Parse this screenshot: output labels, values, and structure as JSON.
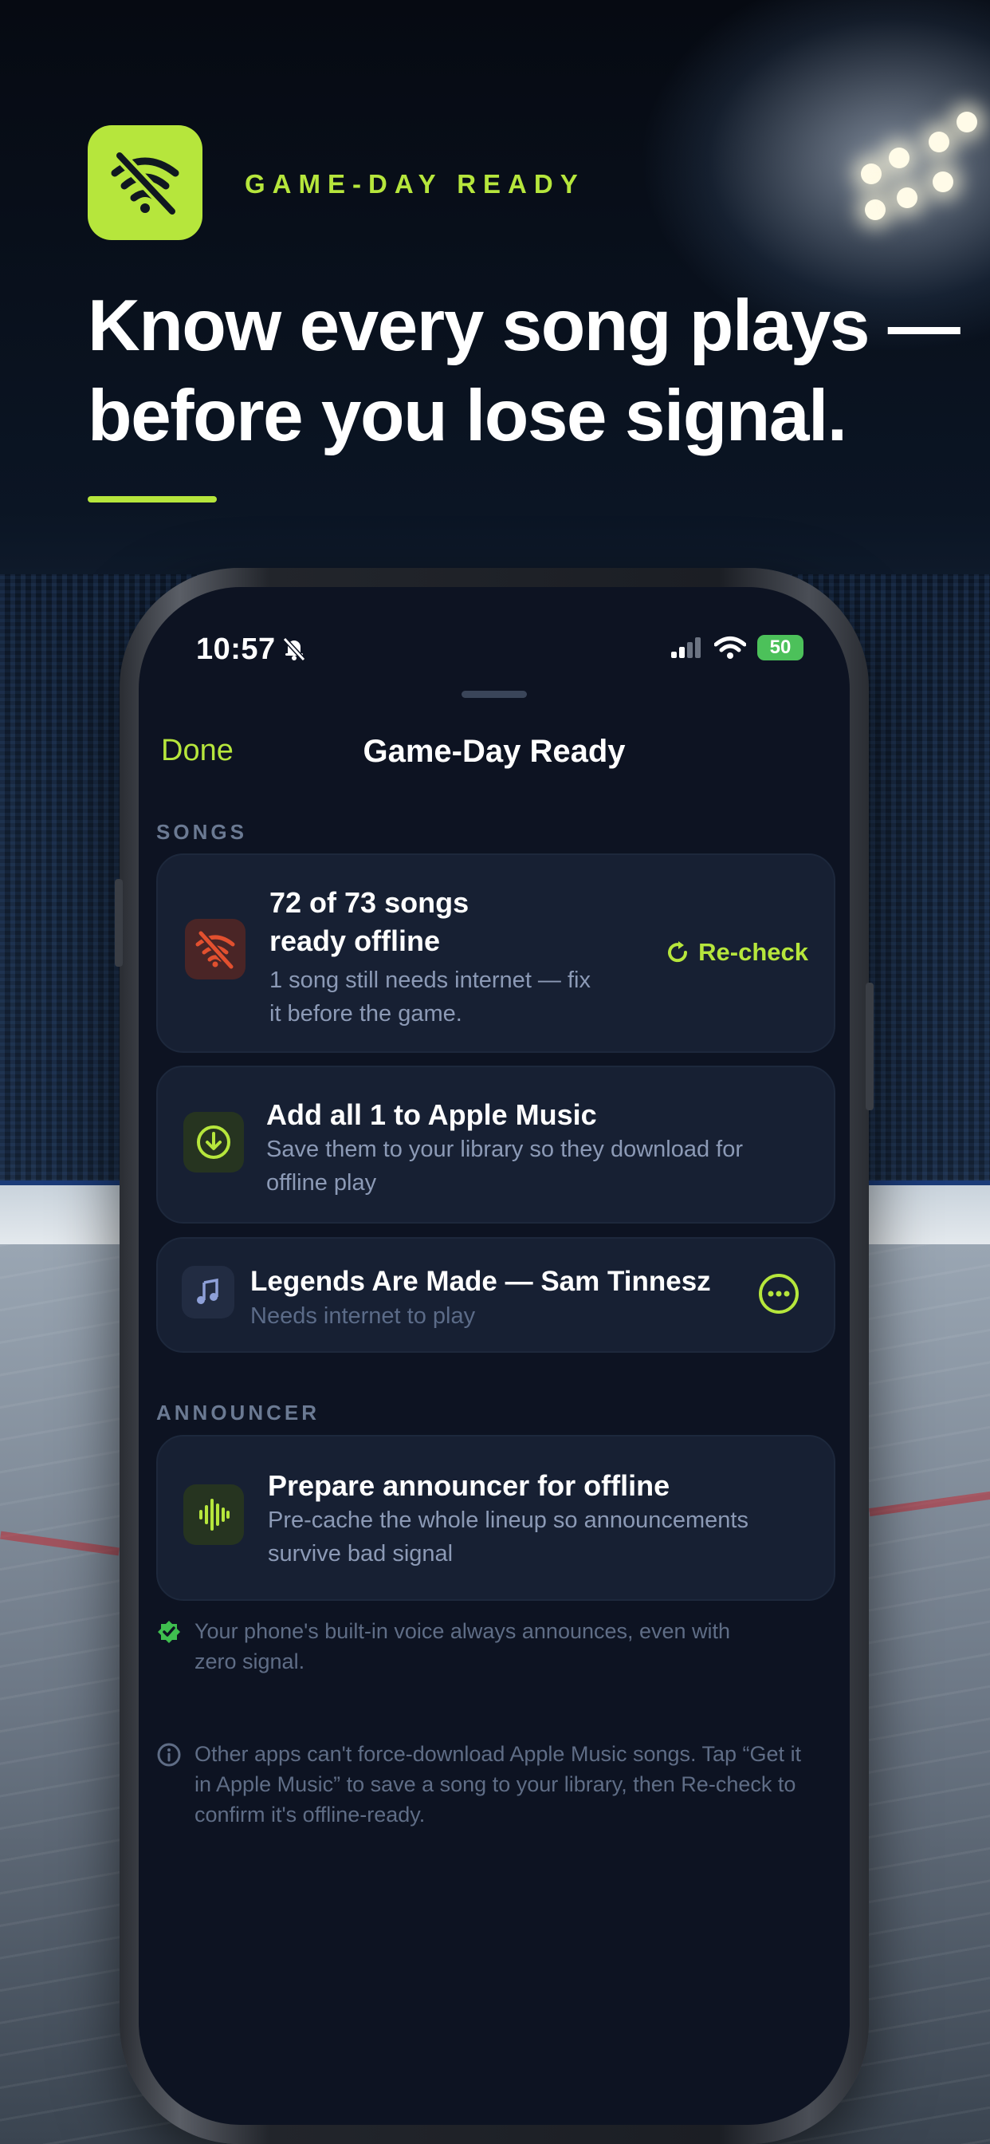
{
  "header": {
    "tagline": "GAME-DAY READY",
    "headline_line1": "Know every song plays —",
    "headline_line2": "before you lose signal.",
    "app_icon": "wifi-off-icon"
  },
  "status_bar": {
    "time": "10:57",
    "battery": "50"
  },
  "sheet": {
    "done_label": "Done",
    "title": "Game-Day Ready"
  },
  "songs_section": {
    "label": "SONGS",
    "summary": {
      "title_line1": "72 of 73 songs",
      "title_line2": "ready offline",
      "subtitle": "1 song still needs internet — fix it before the game.",
      "recheck_label": "Re-check",
      "icon": "wifi-off-icon"
    },
    "add_card": {
      "title": "Add all 1 to Apple Music",
      "subtitle": "Save them to your library so they download for offline play",
      "icon": "download-circle-icon"
    },
    "song_row": {
      "title": "Legends Are Made — Sam Tinnesz",
      "subtitle": "Needs internet to play",
      "icon": "music-note-icon",
      "action_icon": "ellipsis-circle-icon"
    }
  },
  "announcer_section": {
    "label": "ANNOUNCER",
    "card": {
      "title": "Prepare announcer for offline",
      "subtitle": "Pre-cache the whole lineup so announcements survive bad signal",
      "icon": "waveform-icon"
    }
  },
  "notes": {
    "voice_note": "Your phone's built-in voice always announces, even with zero signal.",
    "info_note": "Other apps can't force-download Apple Music songs. Tap “Get it in Apple Music” to save a song to your library, then Re-check to confirm it's offline-ready."
  },
  "colors": {
    "accent": "#b6e63c",
    "warning": "#e2502f",
    "success": "#3fbf4f",
    "background": "#0d1322",
    "card": "#172033"
  }
}
